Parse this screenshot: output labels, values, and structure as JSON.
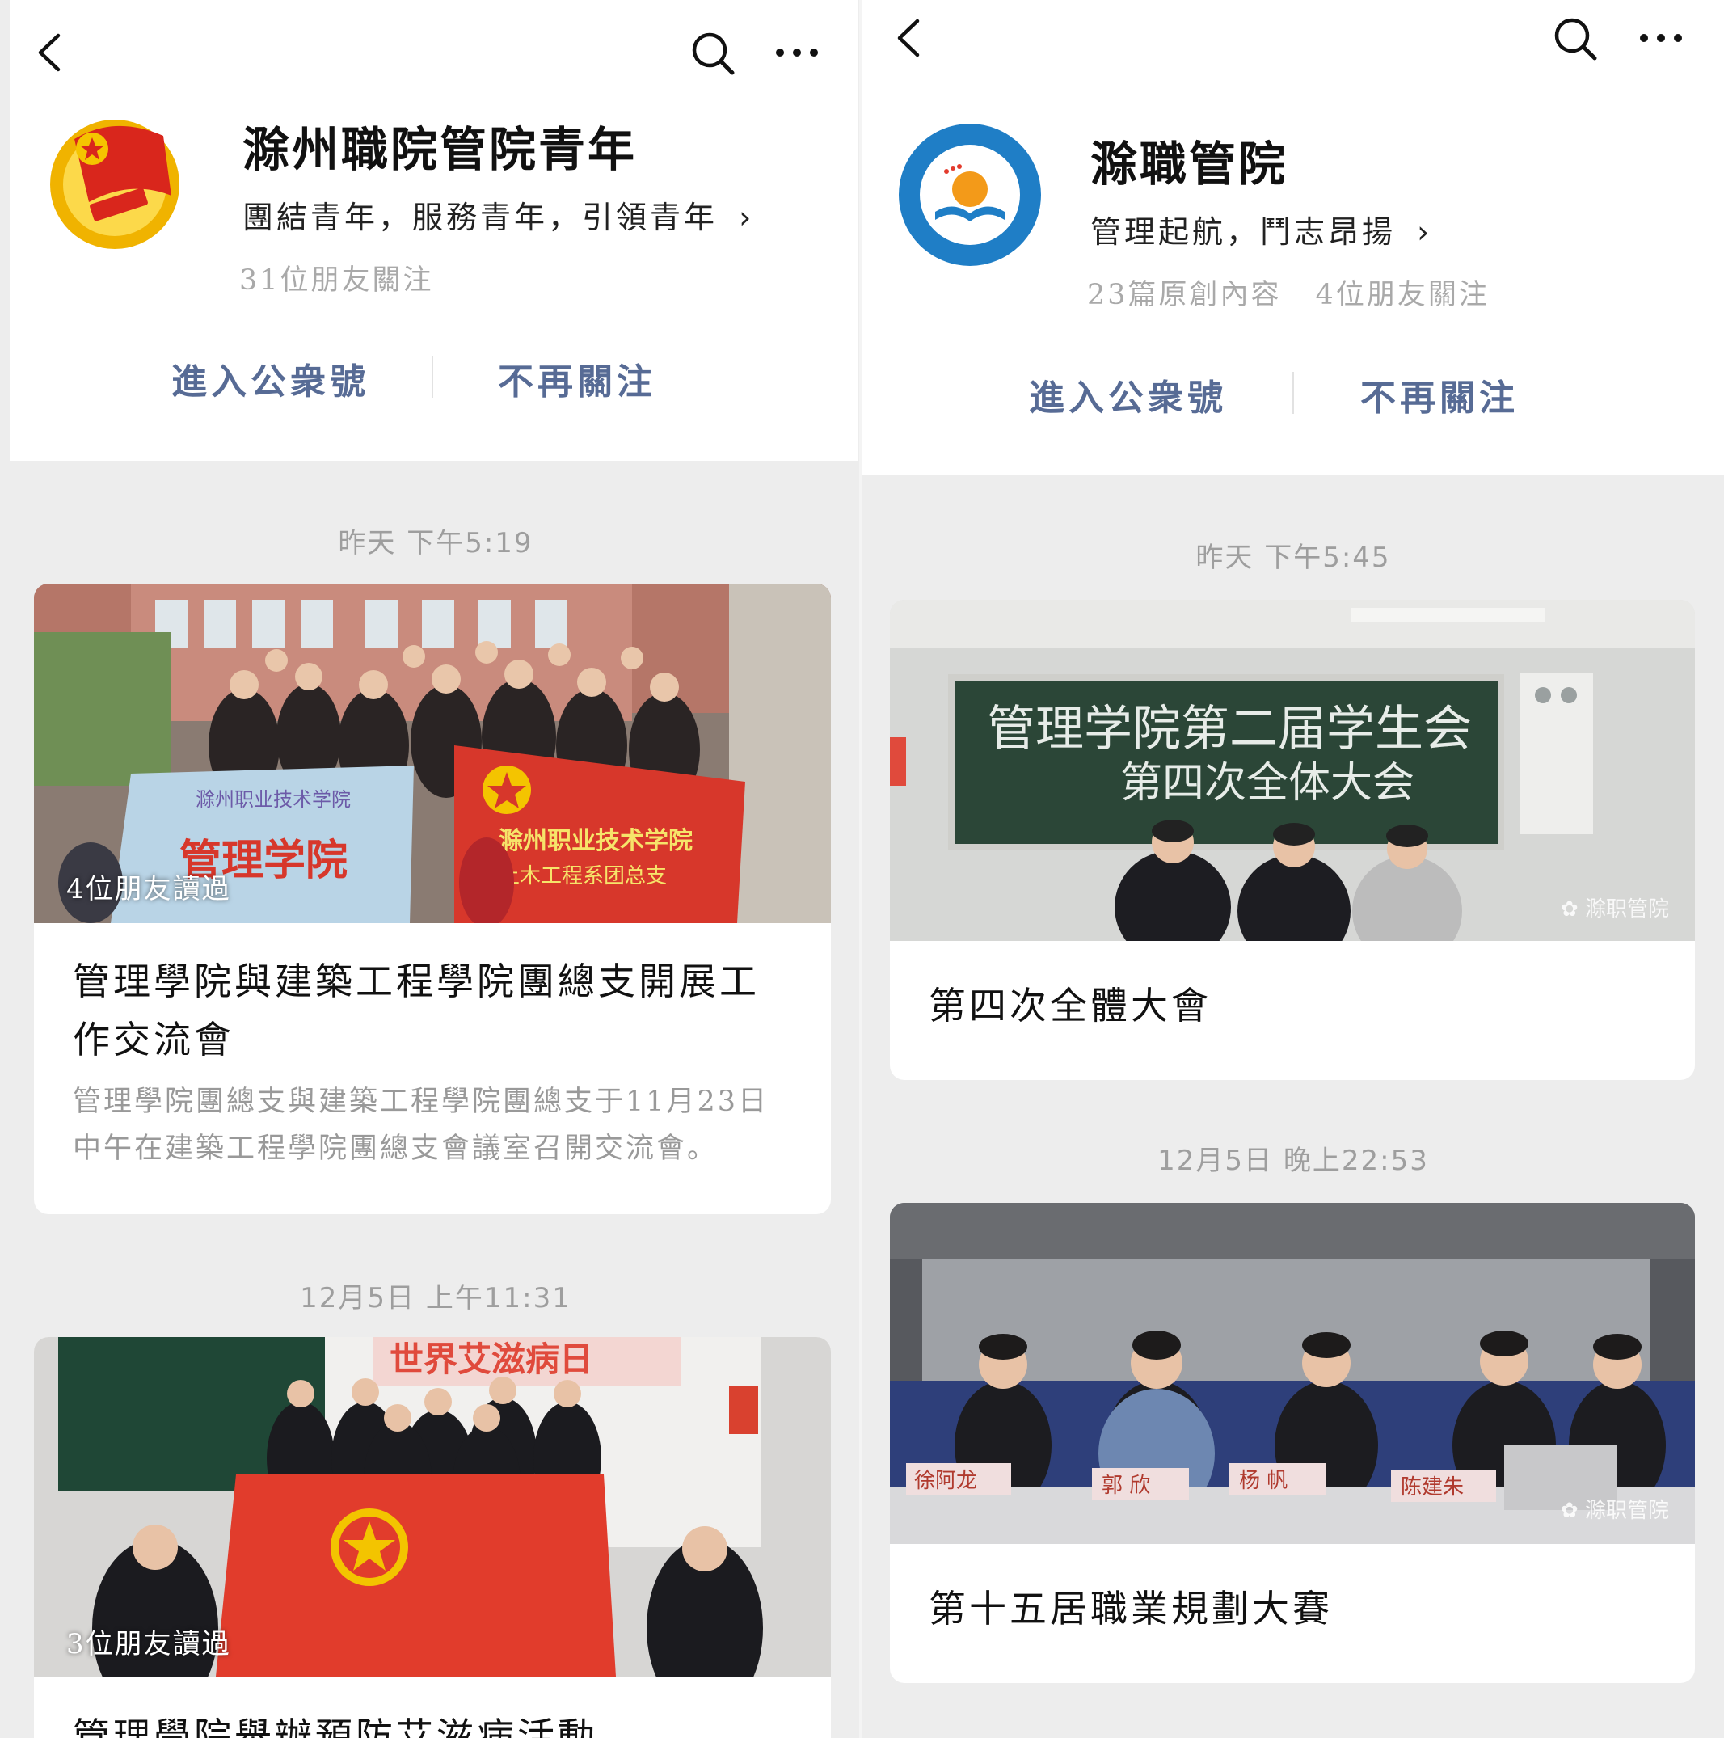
{
  "colors": {
    "link_blue": "#576b95",
    "gray_text": "#9e9e9e",
    "page_bg": "#ededed"
  },
  "left": {
    "account_name": "滁州職院管院青年",
    "description": "團結青年，服務青年，引領青年",
    "followers": "31位朋友關注",
    "enter_label": "進入公衆號",
    "unfollow_label": "不再關注",
    "articles": [
      {
        "time": "昨天 下午5:19",
        "read_by": "4位朋友讀過",
        "banner_left": "管理学院",
        "banner_left_small": "滁州职业技术学院",
        "banner_right": "滁州职业技术学院",
        "banner_right_sub": "土木工程系团总支",
        "title": "管理學院與建築工程學院團總支開展工作交流會",
        "digest": "管理學院團總支與建築工程學院團總支于11月23日中午在建築工程學院團總支會議室召開交流會。"
      },
      {
        "time": "12月5日 上午11:31",
        "read_by": "3位朋友讀過",
        "screen_text": "世界艾滋病日",
        "title": "管理學院舉辦預防艾滋病活動"
      }
    ]
  },
  "right": {
    "account_name": "滁職管院",
    "description": "管理起航，鬥志昂揚",
    "original_count": "23篇原創內容",
    "followers": "4位朋友關注",
    "enter_label": "進入公衆號",
    "unfollow_label": "不再關注",
    "articles": [
      {
        "time": "昨天 下午5:45",
        "watermark": "滁职管院",
        "board_line1": "管理学院第二届学生会",
        "board_line2": "第四次全体大会",
        "title": "第四次全體大會"
      },
      {
        "time": "12月5日 晚上22:53",
        "watermark": "滁职管院",
        "name_cards": [
          "徐阿龙",
          "郭 欣",
          "杨 帆",
          "陈建朱"
        ],
        "title": "第十五居職業規劃大賽"
      }
    ]
  },
  "icons": [
    "back-icon",
    "search-icon",
    "more-icon"
  ]
}
